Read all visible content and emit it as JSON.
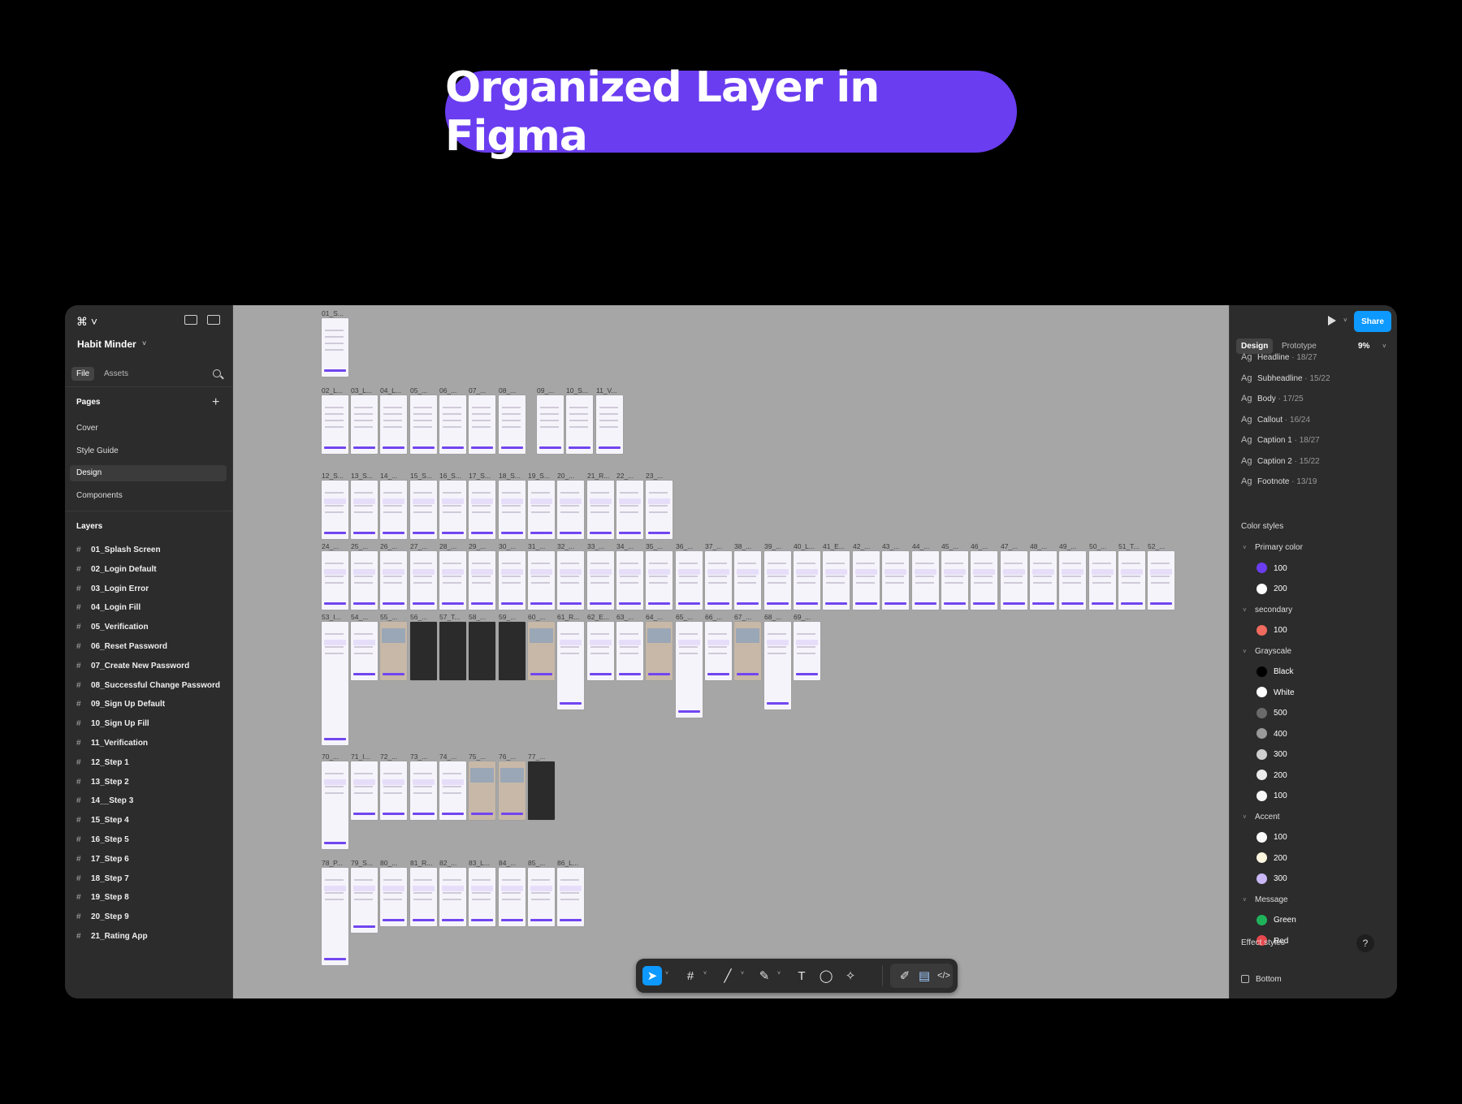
{
  "hero": {
    "title": "Organized Layer in Figma",
    "color": "#6a3df0"
  },
  "left_panel": {
    "project_name": "Habit Minder",
    "tabs": [
      {
        "label": "File",
        "active": true
      },
      {
        "label": "Assets",
        "active": false
      }
    ],
    "pages_title": "Pages",
    "pages": [
      {
        "label": "Cover",
        "active": false
      },
      {
        "label": "Style Guide",
        "active": false
      },
      {
        "label": "Design",
        "active": true
      },
      {
        "label": "Components",
        "active": false
      }
    ],
    "layers_title": "Layers",
    "layers": [
      "01_Splash Screen",
      "02_Login Default",
      "03_Login  Error",
      "04_Login Fill",
      "05_Verification",
      "06_Reset Password",
      "07_Create New Password",
      "08_Successful Change Password",
      "09_Sign Up Default",
      "10_Sign Up Fill",
      "11_Verification",
      "12_Step 1",
      "13_Step 2",
      "14__Step 3",
      "15_Step 4",
      "16_Step 5",
      "17_Step 6",
      "18_Step 7",
      "19_Step 8",
      "20_Step 9",
      "21_Rating App"
    ]
  },
  "canvas": {
    "background": "#a6a6a6",
    "rows": [
      {
        "labels": [
          "01_S..."
        ]
      },
      {
        "labels": [
          "02_L...",
          "03_L...",
          "04_L...",
          "05_...",
          "06_...",
          "07_...",
          "08_...",
          "09_...",
          "10_S...",
          "11_V..."
        ]
      },
      {
        "labels": [
          "12_S...",
          "13_S...",
          "14_...",
          "15_S...",
          "16_S...",
          "17_S...",
          "18_S...",
          "19_S...",
          "20_...",
          "21_R...",
          "22_...",
          "23_..."
        ]
      },
      {
        "labels": [
          "24_...",
          "25_...",
          "26_...",
          "27_...",
          "28_...",
          "29_...",
          "30_...",
          "31_...",
          "32_...",
          "33_...",
          "34_...",
          "35_...",
          "36_...",
          "37_...",
          "38_...",
          "39_...",
          "40_L...",
          "41_E...",
          "42_...",
          "43_...",
          "44_...",
          "45_...",
          "46_...",
          "47_...",
          "48_...",
          "49_...",
          "50_...",
          "51_T...",
          "52_..."
        ]
      },
      {
        "labels": [
          "53_I...",
          "54_...",
          "55_...",
          "56_...",
          "57_T...",
          "58_...",
          "59_...",
          "60_...",
          "61_R...",
          "62_E...",
          "63_...",
          "64_...",
          "65_...",
          "66_...",
          "67_...",
          "68_...",
          "69_..."
        ]
      },
      {
        "labels": [
          "70_...",
          "71_I...",
          "72_...",
          "73_...",
          "74_...",
          "75_...",
          "76_...",
          "77_..."
        ]
      },
      {
        "labels": [
          "78_P...",
          "79_S...",
          "80_...",
          "81_R...",
          "82_...",
          "83_L...",
          "84_...",
          "85_...",
          "86_L..."
        ]
      }
    ]
  },
  "toolbar": {
    "tools": [
      "move-icon",
      "frame-icon",
      "line-icon",
      "pen-icon",
      "text-icon",
      "comment-icon",
      "ai-icon",
      "draw-icon",
      "design-mode-icon",
      "dev-mode-icon"
    ],
    "active_color": "#0d99ff"
  },
  "right_panel": {
    "share_label": "Share",
    "tabs": [
      {
        "label": "Design",
        "active": true
      },
      {
        "label": "Prototype",
        "active": false
      }
    ],
    "zoom": "9%",
    "text_styles": [
      {
        "ag": "Ag",
        "name": "Headline",
        "meta": " · 18/27"
      },
      {
        "ag": "Ag",
        "name": "Subheadline",
        "meta": " · 15/22"
      },
      {
        "ag": "Ag",
        "name": "Body",
        "meta": " · 17/25"
      },
      {
        "ag": "Ag",
        "name": "Callout",
        "meta": " · 16/24"
      },
      {
        "ag": "Ag",
        "name": "Caption 1",
        "meta": " · 18/27"
      },
      {
        "ag": "Ag",
        "name": "Caption 2",
        "meta": " · 15/22"
      },
      {
        "ag": "Ag",
        "name": "Footnote",
        "meta": " · 13/19"
      }
    ],
    "color_styles_title": "Color styles",
    "color_groups": [
      {
        "name": "Primary color",
        "swatches": [
          {
            "label": "100",
            "color": "#6b3df0"
          },
          {
            "label": "200",
            "color": "#ffffff"
          }
        ]
      },
      {
        "name": "secondary",
        "swatches": [
          {
            "label": "100",
            "color": "#f06a5e"
          }
        ]
      },
      {
        "name": "Grayscale",
        "swatches": [
          {
            "label": "Black",
            "color": "#000000"
          },
          {
            "label": "White",
            "color": "#ffffff"
          },
          {
            "label": "500",
            "color": "#6a6a6a"
          },
          {
            "label": "400",
            "color": "#9a9a9a"
          },
          {
            "label": "300",
            "color": "#cfcfcf"
          },
          {
            "label": "200",
            "color": "#ececec"
          },
          {
            "label": "100",
            "color": "#f7f7f7"
          }
        ]
      },
      {
        "name": "Accent",
        "swatches": [
          {
            "label": "100",
            "color": "#fbfbfb"
          },
          {
            "label": "200",
            "color": "#fff6e0"
          },
          {
            "label": "300",
            "color": "#c9b8f5"
          }
        ]
      },
      {
        "name": "Message",
        "swatches": [
          {
            "label": "Green",
            "color": "#1fb25a"
          },
          {
            "label": "Red",
            "color": "#e5484d"
          }
        ]
      }
    ],
    "effect_styles_title": "Effect styles",
    "effect_item": "Bottom",
    "help_label": "?"
  }
}
